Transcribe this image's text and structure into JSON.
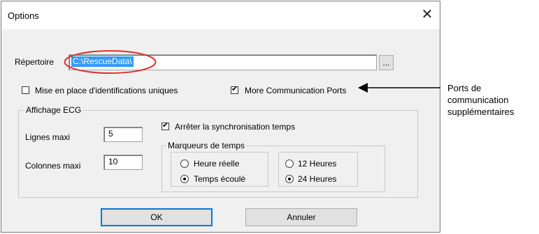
{
  "window": {
    "title": "Options",
    "close_label": "✕"
  },
  "directory": {
    "label": "Répertoire",
    "value": "C:\\RescueData\\",
    "browse_label": "..."
  },
  "checkboxes": {
    "unique_ids": {
      "label": "Mise en place d'identifications uniques",
      "checked": false
    },
    "more_ports": {
      "label": "More Communication Ports",
      "checked": true
    }
  },
  "ecg": {
    "group_label": "Affichage ECG",
    "max_lines_label": "Lignes maxi",
    "max_lines_value": "5",
    "max_columns_label": "Colonnes maxi",
    "max_columns_value": "10",
    "stop_sync_label": "Arrêter la synchronisation temps",
    "stop_sync_checked": true,
    "time_markers": {
      "group_label": "Marqueurs de temps",
      "real_time_label": "Heure réelle",
      "elapsed_label": "Temps écoulé",
      "h12_label": "12 Heures",
      "h24_label": "24 Heures",
      "selected_mode": "Temps écoulé",
      "selected_format": "24 Heures"
    }
  },
  "buttons": {
    "ok_label": "OK",
    "cancel_label": "Annuler"
  },
  "annotation": {
    "line1": "Ports de",
    "line2": "communication",
    "line3": "supplémentaires",
    "highlight_color": "#e03030"
  },
  "check_glyph": "✔"
}
